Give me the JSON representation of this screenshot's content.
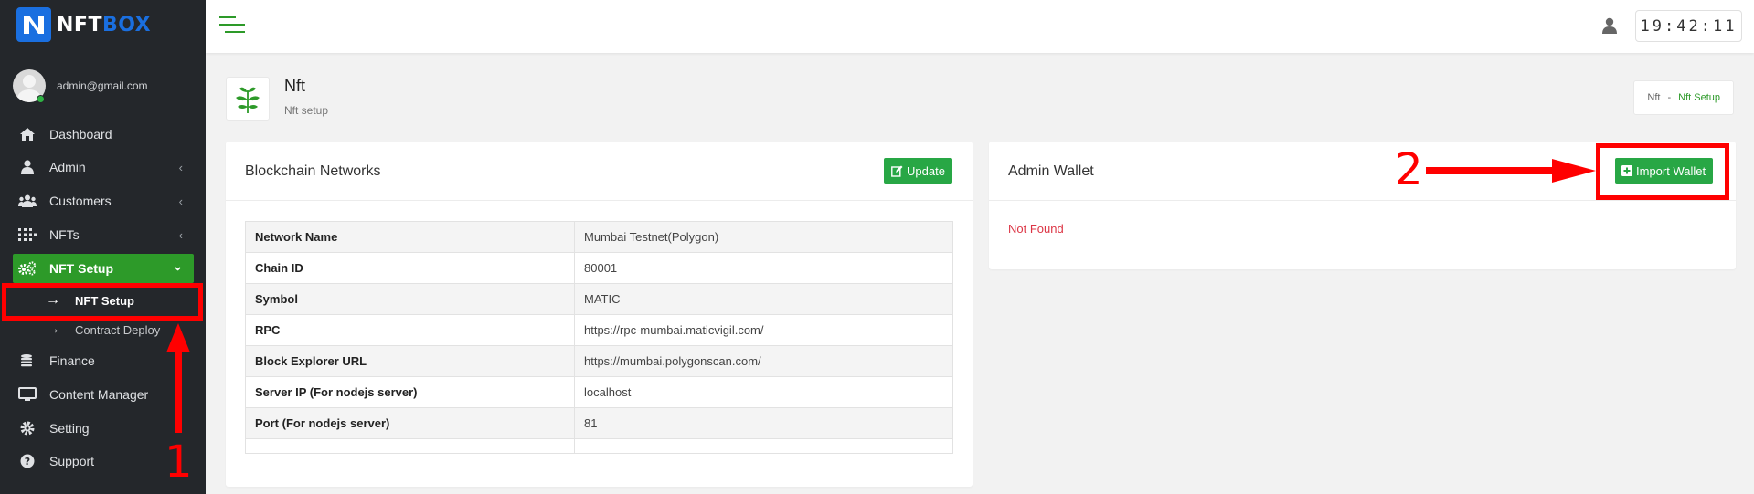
{
  "app": {
    "brand_part1": "NFT",
    "brand_part2": "BOX",
    "user_email": "admin@gmail.com",
    "clock_time": "19:42:11"
  },
  "sidebar": {
    "items": [
      {
        "label": "Dashboard",
        "icon": "home-icon"
      },
      {
        "label": "Admin",
        "icon": "user-icon",
        "has_children": true
      },
      {
        "label": "Customers",
        "icon": "users-icon",
        "has_children": true
      },
      {
        "label": "NFTs",
        "icon": "grid-icon",
        "has_children": true
      },
      {
        "label": "NFT Setup",
        "icon": "gears-icon",
        "has_children": true,
        "active": true
      },
      {
        "label": "Finance",
        "icon": "coins-icon"
      },
      {
        "label": "Content Manager",
        "icon": "monitor-icon"
      },
      {
        "label": "Setting",
        "icon": "gear-icon"
      },
      {
        "label": "Support",
        "icon": "question-icon"
      }
    ],
    "subitems": [
      {
        "label": "NFT Setup",
        "active": true
      },
      {
        "label": "Contract Deploy",
        "active": false
      }
    ]
  },
  "page": {
    "title": "Nft",
    "subtitle": "Nft setup",
    "breadcrumb": [
      "Nft",
      "-",
      "Nft Setup"
    ]
  },
  "blockchain_card": {
    "title": "Blockchain Networks",
    "update_label": "Update",
    "rows": [
      {
        "key": "Network Name",
        "value": "Mumbai Testnet(Polygon)"
      },
      {
        "key": "Chain ID",
        "value": "80001"
      },
      {
        "key": "Symbol",
        "value": "MATIC"
      },
      {
        "key": "RPC",
        "value": "https://rpc-mumbai.maticvigil.com/"
      },
      {
        "key": "Block Explorer URL",
        "value": "https://mumbai.polygonscan.com/"
      },
      {
        "key": "Server IP (For nodejs server)",
        "value": "localhost"
      },
      {
        "key": "Port (For nodejs server)",
        "value": "81"
      }
    ]
  },
  "wallet_card": {
    "title": "Admin Wallet",
    "import_label": "Import Wallet",
    "status": "Not Found"
  },
  "annotations": {
    "label1": "1",
    "label2": "2"
  },
  "colors": {
    "accent_green": "#2d9a29",
    "brand_blue": "#1a6fe0",
    "annotation_red": "#ff0000",
    "error_red": "#dc3545"
  }
}
